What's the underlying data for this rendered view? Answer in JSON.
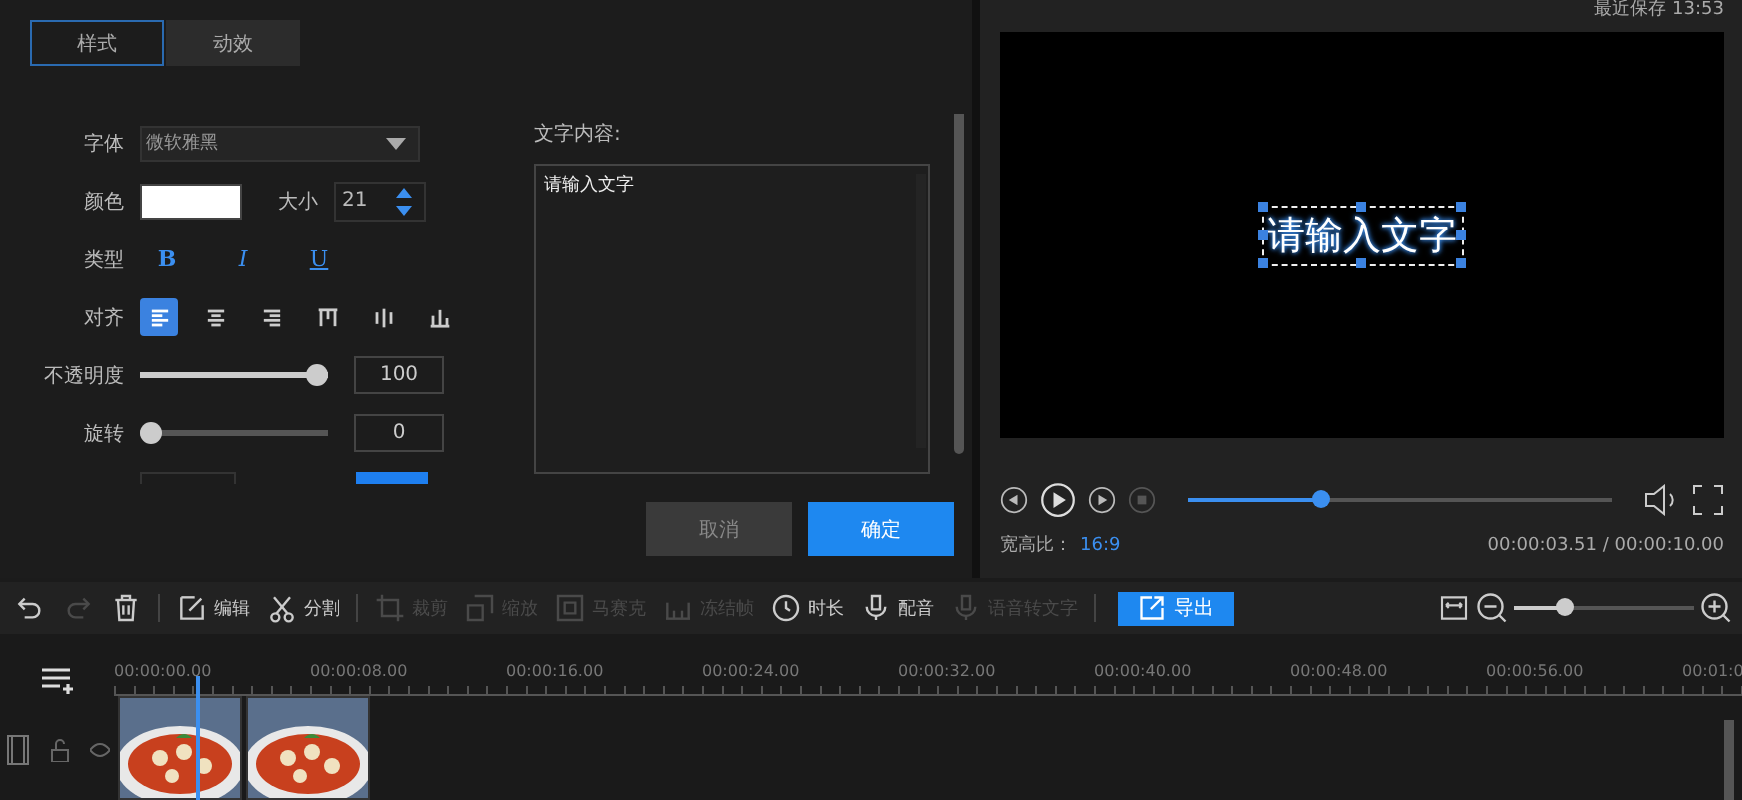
{
  "tabs": [
    {
      "label": "样式",
      "selected": true
    },
    {
      "label": "动效",
      "selected": false
    }
  ],
  "style_form": {
    "font": {
      "label": "字体",
      "value": "微软雅黑"
    },
    "color": {
      "label": "颜色"
    },
    "size": {
      "label": "大小",
      "value": "21"
    },
    "type": {
      "label": "类型",
      "buttons": [
        {
          "kind": "bold",
          "label": "B"
        },
        {
          "kind": "italic",
          "label": "I"
        },
        {
          "kind": "underline",
          "label": "U"
        }
      ]
    },
    "align": {
      "label": "对齐",
      "options": [
        {
          "kind": "left",
          "selected": true
        },
        {
          "kind": "center",
          "selected": false
        },
        {
          "kind": "right",
          "selected": false
        },
        {
          "kind": "top",
          "selected": false
        },
        {
          "kind": "middle",
          "selected": false
        },
        {
          "kind": "bottom",
          "selected": false
        }
      ]
    },
    "opacity": {
      "label": "不透明度",
      "level": 1,
      "value": "100"
    },
    "rotation": {
      "label": "旋转",
      "level": 0,
      "value": "0"
    }
  },
  "text_content": {
    "label": "文字内容:",
    "value": "请输入文字"
  },
  "buttons": [
    {
      "label": "取消",
      "kind": "secondary"
    },
    {
      "label": "确定",
      "kind": "primary"
    }
  ],
  "preview": {
    "last_saved": "最近保存 13:53",
    "caption": "请输入文字",
    "progress": {
      "level": 0.31
    },
    "aspect_label": "宽高比：",
    "aspect_value": "16:9",
    "time": "00:00:03.51 / 00:00:10.00"
  },
  "toolbar": [
    {
      "kind": "undo",
      "disabled": false
    },
    {
      "kind": "redo",
      "disabled": true
    },
    {
      "kind": "delete",
      "disabled": false
    },
    {
      "kind": "separator"
    },
    {
      "kind": "edit",
      "label": "编辑",
      "disabled": false
    },
    {
      "kind": "split",
      "label": "分割",
      "disabled": false
    },
    {
      "kind": "separator"
    },
    {
      "kind": "crop",
      "label": "裁剪",
      "disabled": true
    },
    {
      "kind": "scale",
      "label": "缩放",
      "disabled": true
    },
    {
      "kind": "mosaic",
      "label": "马赛克",
      "disabled": true
    },
    {
      "kind": "freeze",
      "label": "冻结帧",
      "disabled": true
    },
    {
      "kind": "duration",
      "label": "时长",
      "disabled": false
    },
    {
      "kind": "dub",
      "label": "配音",
      "disabled": false
    },
    {
      "kind": "speech",
      "label": "语音转文字",
      "disabled": true
    },
    {
      "kind": "separator"
    }
  ],
  "export_button": "导出",
  "zoom": {
    "level": 0.28
  },
  "ruler": [
    "00:00:00.00",
    "00:00:08.00",
    "00:00:16.00",
    "00:00:24.00",
    "00:00:32.00",
    "00:00:40.00",
    "00:00:48.00",
    "00:00:56.00",
    "00:01:0"
  ]
}
